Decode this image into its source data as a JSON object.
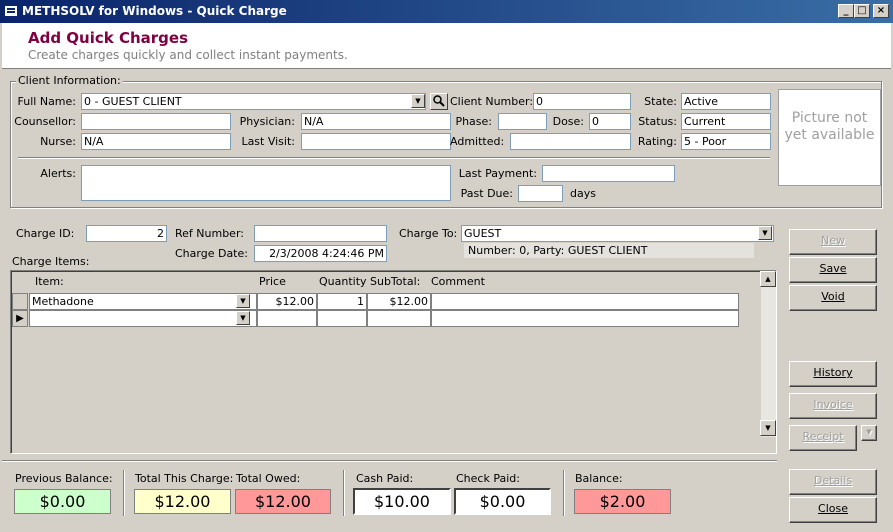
{
  "window": {
    "title": "METHSOLV for Windows - Quick Charge",
    "min": "_",
    "max": "□",
    "close": "×"
  },
  "header": {
    "title": "Add Quick Charges",
    "subtitle": "Create charges quickly and collect instant payments."
  },
  "client": {
    "legend": "Client Information:",
    "full_name_label": "Full Name:",
    "full_name": "0 - GUEST CLIENT",
    "counsellor_label": "Counsellor:",
    "counsellor": "",
    "nurse_label": "Nurse:",
    "nurse": "N/A",
    "physician_label": "Physician:",
    "physician": "N/A",
    "last_visit_label": "Last Visit:",
    "last_visit": "",
    "client_number_label": "Client Number:",
    "client_number": "0",
    "phase_label": "Phase:",
    "phase": "",
    "dose_label": "Dose:",
    "dose": "0",
    "admitted_label": "Admitted:",
    "admitted": "",
    "state_label": "State:",
    "state": "Active",
    "status_label": "Status:",
    "status": "Current",
    "rating_label": "Rating:",
    "rating": "5 - Poor",
    "alerts_label": "Alerts:",
    "alerts": "",
    "last_payment_label": "Last Payment:",
    "last_payment": "",
    "past_due_label": "Past Due:",
    "past_due": "",
    "days_label": "days",
    "picture": "Picture not yet available"
  },
  "charge": {
    "charge_id_label": "Charge ID:",
    "charge_id": "2",
    "ref_number_label": "Ref Number:",
    "ref_number": "",
    "charge_date_label": "Charge Date:",
    "charge_date": "2/3/2008 4:24:46 PM",
    "charge_to_label": "Charge To:",
    "charge_to": "GUEST",
    "charge_to_detail": "Number: 0, Party: GUEST CLIENT",
    "items_label": "Charge Items:"
  },
  "grid": {
    "headers": {
      "item": "Item:",
      "price": "Price",
      "quantity": "Quantity",
      "subtotal": "SubTotal:",
      "comment": "Comment"
    },
    "rows": [
      {
        "item": "Methadone",
        "price": "$12.00",
        "quantity": "1",
        "subtotal": "$12.00",
        "comment": ""
      }
    ],
    "new_row_marker": "▶"
  },
  "buttons": {
    "new": "New",
    "save": "Save",
    "void": "Void",
    "history": "History",
    "invoice": "Invoice",
    "receipt": "Receipt",
    "details": "Details",
    "close": "Close"
  },
  "totals": {
    "previous_balance_label": "Previous Balance:",
    "previous_balance": "$0.00",
    "total_this_charge_label": "Total This Charge:",
    "total_this_charge": "$12.00",
    "total_owed_label": "Total Owed:",
    "total_owed": "$12.00",
    "cash_paid_label": "Cash Paid:",
    "cash_paid": "$10.00",
    "check_paid_label": "Check Paid:",
    "check_paid": "$0.00",
    "balance_label": "Balance:",
    "balance": "$2.00"
  },
  "colors": {
    "title_bar": "#0a246a",
    "header_title": "#800040",
    "prev_balance_bg": "#ccffcc",
    "total_charge_bg": "#ffffcc",
    "owed_bg": "#ff9999",
    "balance_bg": "#ff9999"
  },
  "icons": {
    "window": "app-window-icon",
    "search": "magnifier-icon",
    "dropdown": "dropdown-arrow-icon",
    "record_selector": "current-record-icon"
  }
}
